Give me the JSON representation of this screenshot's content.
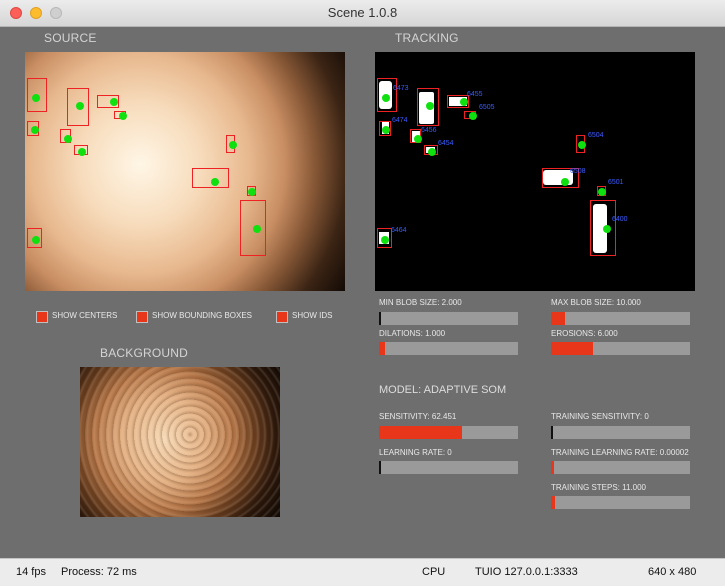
{
  "window": {
    "title": "Scene 1.0.8"
  },
  "sections": {
    "source": "SOURCE",
    "tracking": "TRACKING",
    "background": "BACKGROUND"
  },
  "toggles": [
    {
      "label": "SHOW CENTERS",
      "checked": true
    },
    {
      "label": "SHOW BOUNDING BOXES",
      "checked": true
    },
    {
      "label": "SHOW IDS",
      "checked": true
    }
  ],
  "sliders": {
    "min_blob_size": {
      "label": "MIN BLOB SIZE: 2.000",
      "fraction": 0.01
    },
    "max_blob_size": {
      "label": "MAX BLOB SIZE: 10.000",
      "fraction": 0.1
    },
    "dilations": {
      "label": "DILATIONS: 1.000",
      "fraction": 0.04
    },
    "erosions": {
      "label": "EROSIONS: 6.000",
      "fraction": 0.3
    },
    "sensitivity": {
      "label": "SENSITIVITY: 62.451",
      "fraction": 0.6
    },
    "training_sensitivity": {
      "label": "TRAINING SENSITIVITY: 0",
      "fraction": 0.0
    },
    "learning_rate": {
      "label": "LEARNING RATE: 0",
      "fraction": 0.0
    },
    "training_learning_rate": {
      "label": "TRAINING LEARNING RATE: 0.00002",
      "fraction": 0.02
    },
    "training_steps": {
      "label": "TRAINING STEPS: 11.000",
      "fraction": 0.03
    }
  },
  "model": {
    "label": "MODEL: ADAPTIVE SOM"
  },
  "tracking_ids": [
    "6473",
    "6455",
    "6505",
    "6474",
    "6456",
    "6454",
    "6504",
    "6508",
    "6501",
    "6400",
    "6464"
  ],
  "status": {
    "fps": "14 fps",
    "process": "Process:  72 ms",
    "cpu": "CPU",
    "tuio": "TUIO  127.0.0.1:3333",
    "resolution": "640 x 480"
  },
  "colors": {
    "accent": "#e8361a",
    "center_dot": "#10e010",
    "id_text": "#3a5cff",
    "bbox": "#e22222"
  }
}
